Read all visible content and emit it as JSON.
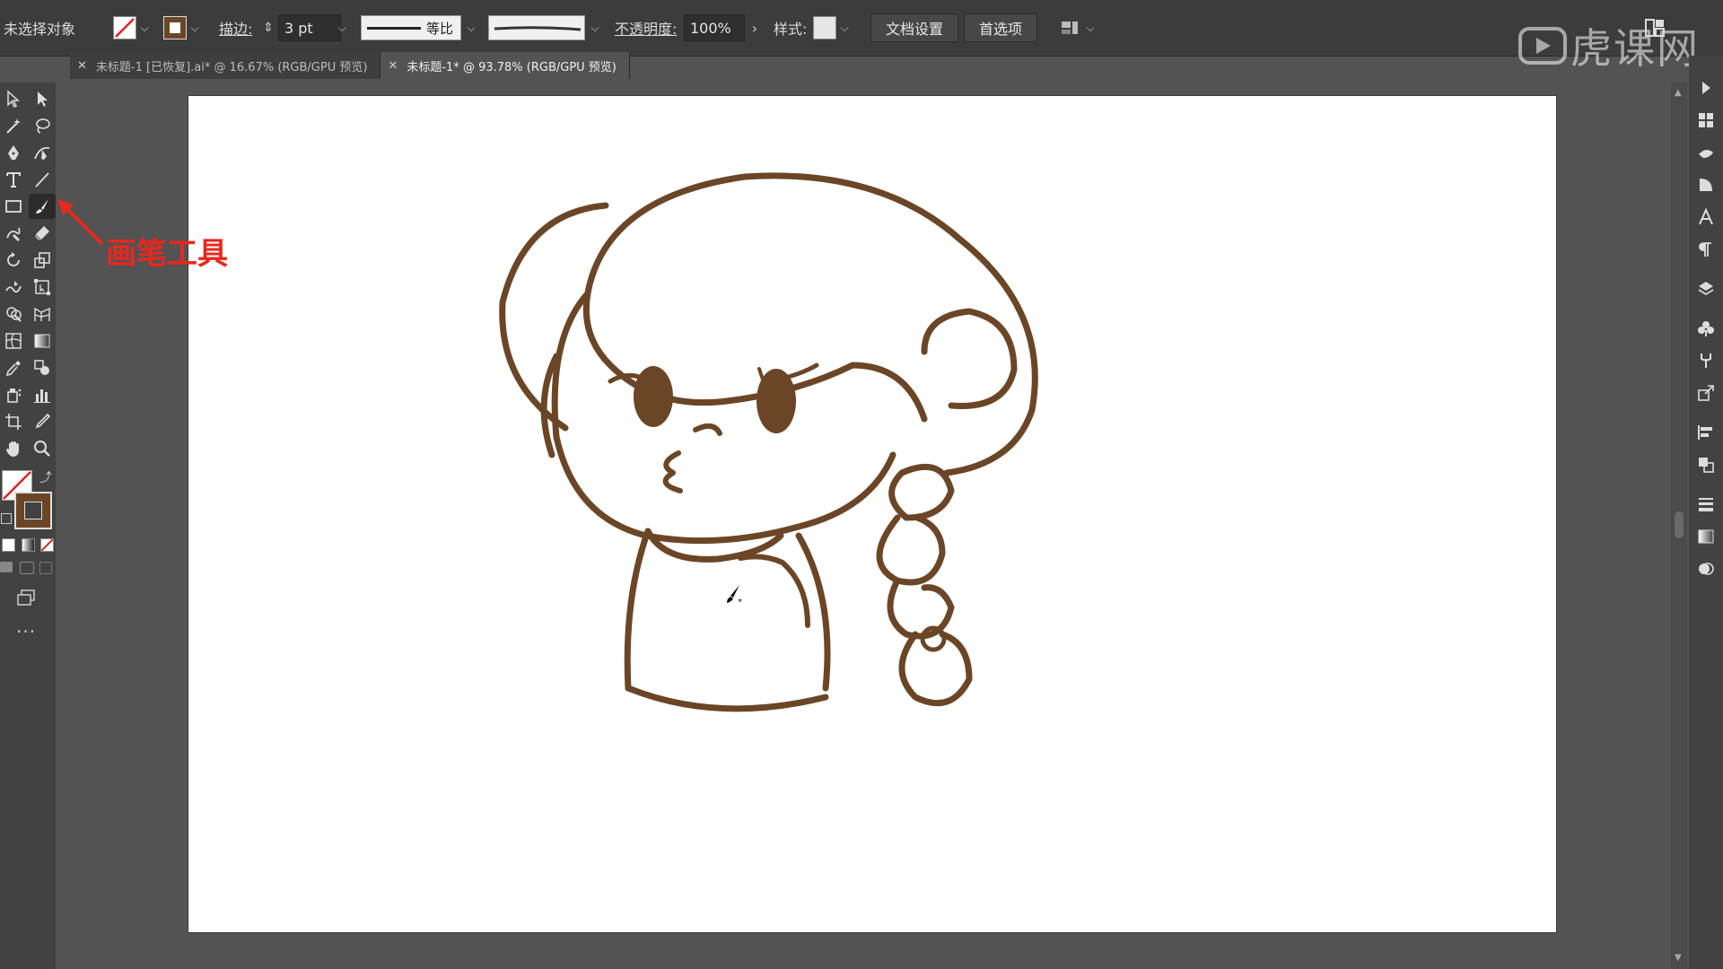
{
  "controlbar": {
    "selection_status": "未选择对象",
    "stroke_label": "描边:",
    "stroke_weight": "3 pt",
    "stroke_profile": "等比",
    "opacity_label": "不透明度:",
    "opacity_value": "100%",
    "style_label": "样式:",
    "doc_setup": "文档设置",
    "preferences": "首选项"
  },
  "tabs": [
    {
      "label": "未标题-1 [已恢复].ai* @ 16.67% (RGB/GPU 预览)",
      "active": false
    },
    {
      "label": "未标题-1* @ 93.78% (RGB/GPU 预览)",
      "active": true
    }
  ],
  "annotation": {
    "text": "画笔工具",
    "color": "#e8281e"
  },
  "watermark": {
    "text": "虎课网"
  },
  "colors": {
    "stroke_brown": "#6b4626",
    "ui_dark": "#3c3c3c",
    "canvas_bg": "#535353",
    "artboard": "#ffffff"
  },
  "icons": [
    "selection-tool-icon",
    "direct-selection-tool-icon",
    "magic-wand-icon",
    "lasso-icon",
    "pen-tool-icon",
    "curvature-tool-icon",
    "type-tool-icon",
    "line-tool-icon",
    "rectangle-tool-icon",
    "paintbrush-tool-icon",
    "shaper-tool-icon",
    "eraser-tool-icon",
    "rotate-tool-icon",
    "scale-tool-icon",
    "warp-tool-icon",
    "free-transform-icon",
    "shape-builder-icon",
    "perspective-grid-icon",
    "mesh-tool-icon",
    "gradient-tool-icon",
    "eyedropper-icon",
    "blend-tool-icon",
    "symbol-sprayer-icon",
    "graph-tool-icon",
    "artboard-tool-icon",
    "slice-tool-icon",
    "hand-tool-icon",
    "zoom-tool-icon"
  ]
}
